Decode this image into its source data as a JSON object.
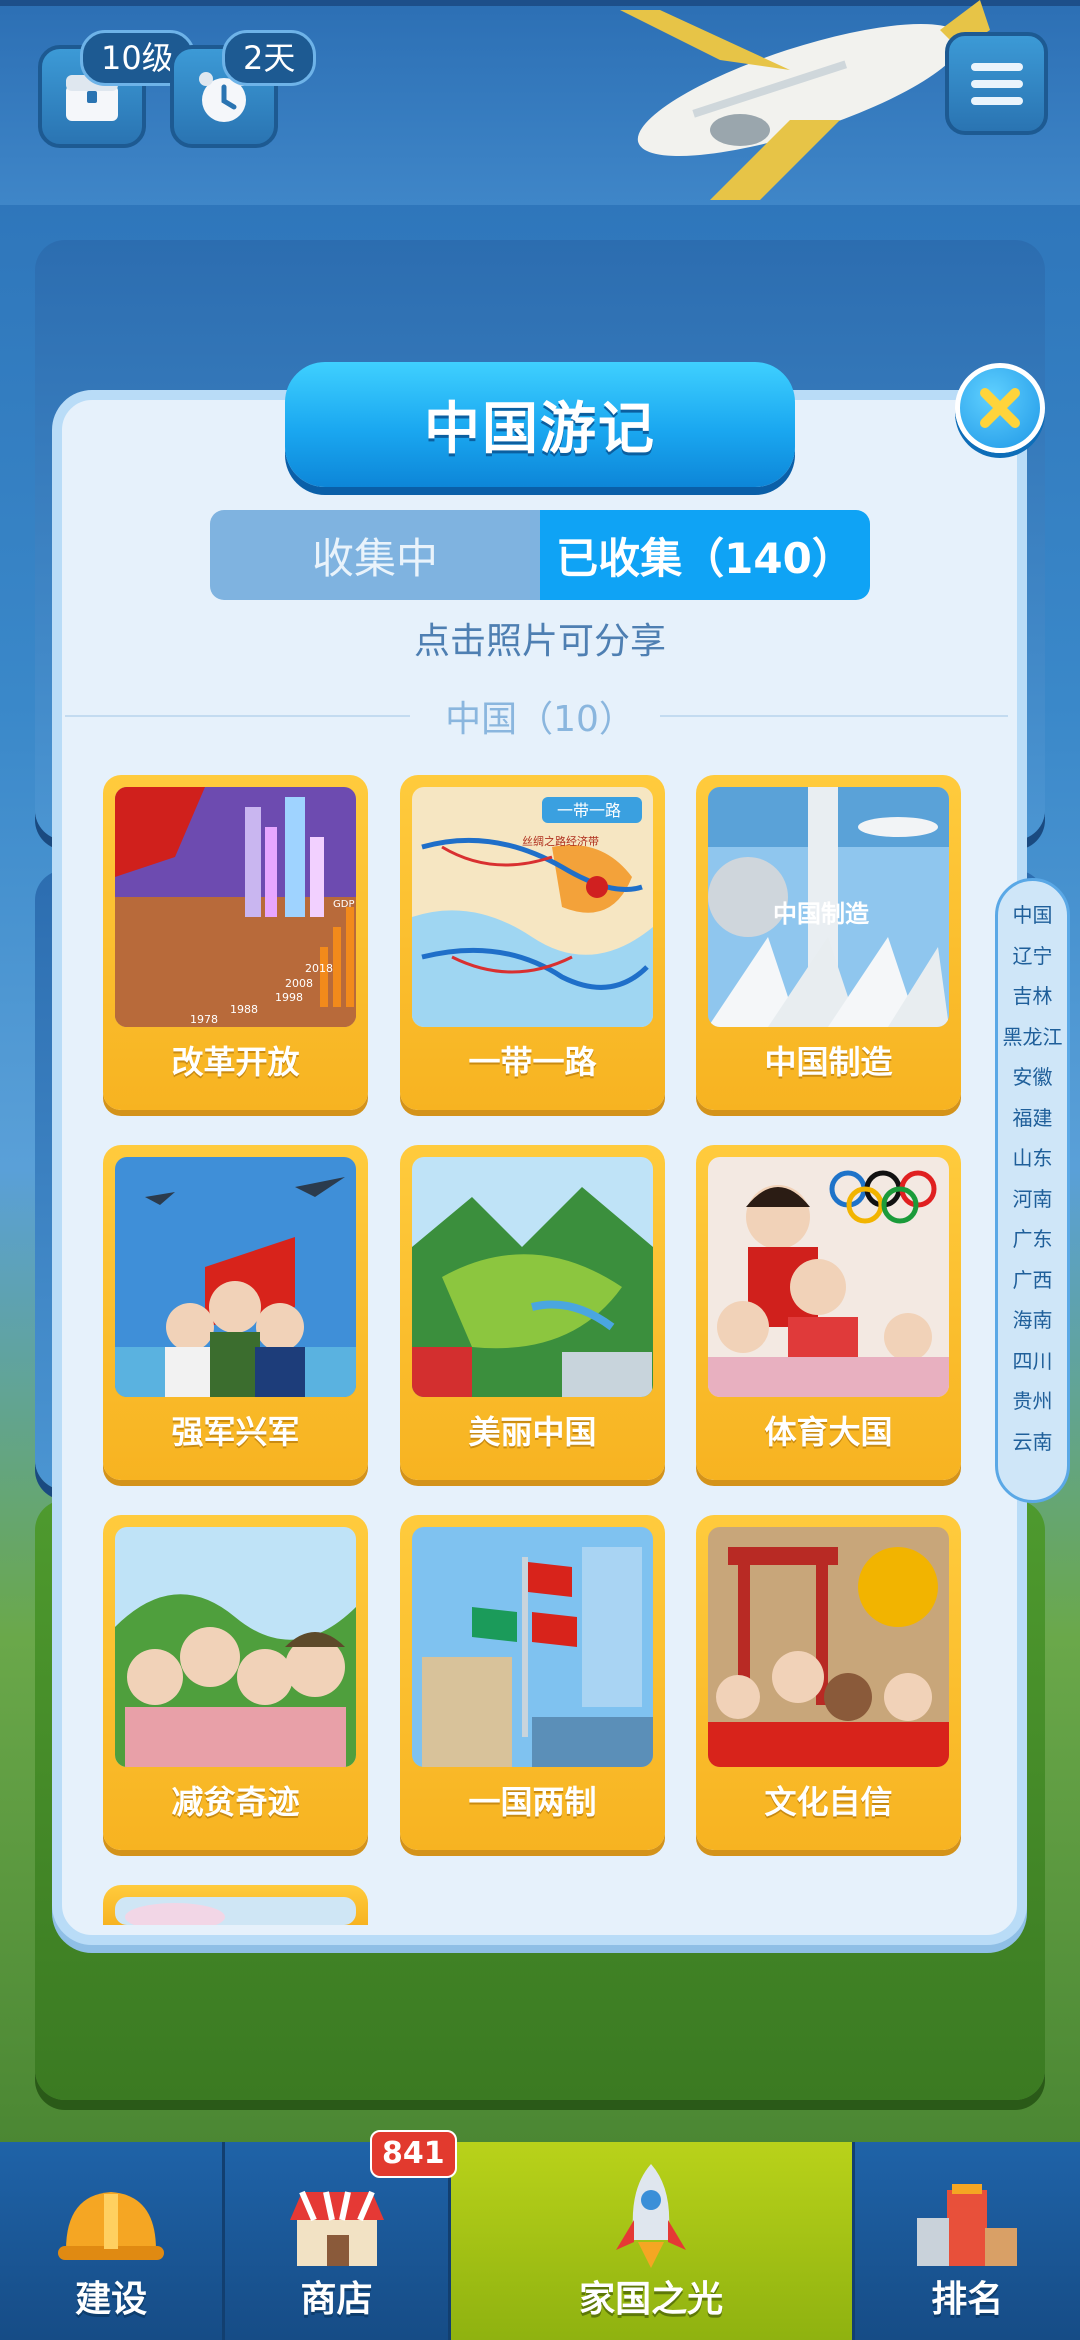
{
  "top": {
    "level_badge": "10级",
    "days_badge": "2天"
  },
  "modal": {
    "title": "中国游记",
    "tabs": [
      {
        "label": "收集中",
        "active": false
      },
      {
        "label": "已收集（140）",
        "active": true
      }
    ],
    "hint": "点击照片可分享",
    "section_title": "中国（10）",
    "cards": [
      {
        "label": "改革开放"
      },
      {
        "label": "一带一路"
      },
      {
        "label": "中国制造"
      },
      {
        "label": "强军兴军"
      },
      {
        "label": "美丽中国"
      },
      {
        "label": "体育大国"
      },
      {
        "label": "减贫奇迹"
      },
      {
        "label": "一国两制"
      },
      {
        "label": "文化自信"
      }
    ],
    "card_texts": {
      "reform_years": [
        "1978",
        "1988",
        "1998",
        "2008",
        "2018"
      ],
      "reform_gdp": "GDP",
      "belt_road_title": "一带一路",
      "belt_road_sub": "丝绸之路经济带",
      "made_in_china": "中国制造"
    }
  },
  "side_index": [
    "中国",
    "辽宁",
    "吉林",
    "黑龙江",
    "安徽",
    "福建",
    "山东",
    "河南",
    "广东",
    "广西",
    "海南",
    "四川",
    "贵州",
    "云南"
  ],
  "bottom_nav": {
    "items": [
      {
        "label": "建设",
        "icon": "helmet-icon"
      },
      {
        "label": "商店",
        "icon": "shop-icon"
      },
      {
        "label": "家国之光",
        "icon": "rocket-icon"
      },
      {
        "label": "排名",
        "icon": "podium-icon"
      }
    ],
    "shop_badge": "841"
  },
  "colors": {
    "accent": "#0fa3f5",
    "card": "#f7b321",
    "nav_active": "#b9d21a",
    "badge": "#e23a2e"
  }
}
